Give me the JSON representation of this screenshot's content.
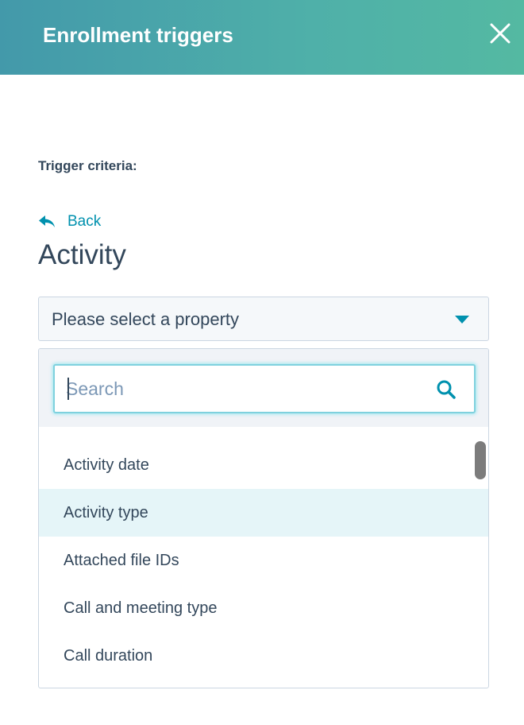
{
  "header": {
    "title": "Enrollment triggers"
  },
  "criteria": {
    "label": "Trigger criteria:"
  },
  "back": {
    "label": "Back"
  },
  "section": {
    "title": "Activity"
  },
  "property_select": {
    "value": "Please select a property"
  },
  "search": {
    "placeholder": "Search",
    "value": ""
  },
  "options": [
    {
      "label": "Activity date"
    },
    {
      "label": "Activity type"
    },
    {
      "label": "Attached file IDs"
    },
    {
      "label": "Call and meeting type"
    },
    {
      "label": "Call duration"
    }
  ],
  "highlighted_index": 1,
  "colors": {
    "header_start": "#4399aa",
    "header_end": "#54b9a2",
    "link": "#0091ae",
    "text": "#33475b",
    "highlight": "#e5f5f8",
    "focus_border": "#7fd1de"
  },
  "icons": {
    "close": "close-icon",
    "back": "back-arrow-icon",
    "caret": "caret-down-icon",
    "search": "search-icon"
  }
}
